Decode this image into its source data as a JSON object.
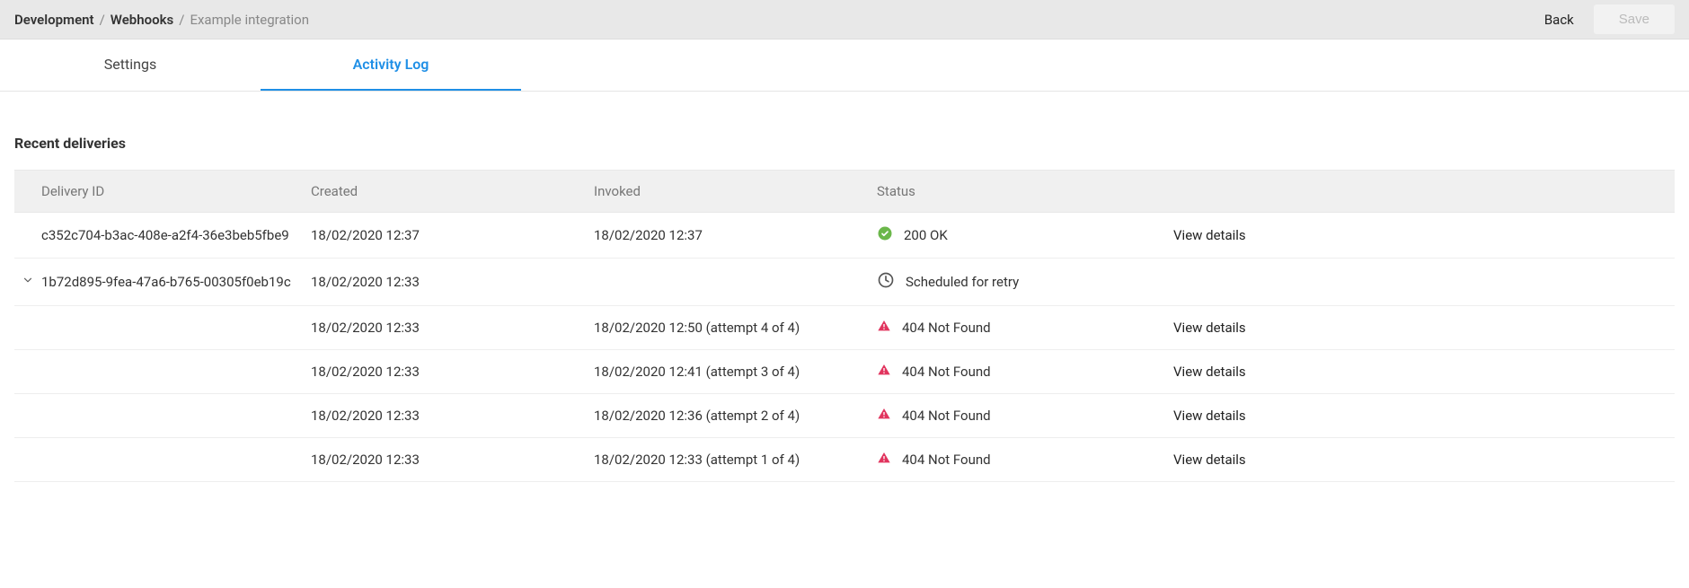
{
  "breadcrumb": {
    "item0": "Development",
    "item1": "Webhooks",
    "item2": "Example integration",
    "sep": "/"
  },
  "topbar": {
    "back": "Back",
    "save": "Save"
  },
  "tabs": {
    "settings": "Settings",
    "activity": "Activity Log"
  },
  "section": {
    "title": "Recent deliveries"
  },
  "table": {
    "headers": {
      "id": "Delivery ID",
      "created": "Created",
      "invoked": "Invoked",
      "status": "Status"
    },
    "rows": [
      {
        "id": "c352c704-b3ac-408e-a2f4-36e3beb5fbe9",
        "created": "18/02/2020 12:37",
        "invoked": "18/02/2020 12:37",
        "status_text": "200 OK",
        "action": "View details"
      },
      {
        "id": "1b72d895-9fea-47a6-b765-00305f0eb19c",
        "created": "18/02/2020 12:33",
        "invoked": "",
        "status_text": "Scheduled for retry",
        "action": ""
      }
    ],
    "attempts": [
      {
        "created": "18/02/2020 12:33",
        "invoked": "18/02/2020 12:50 (attempt 4 of 4)",
        "status_text": "404 Not Found",
        "action": "View details"
      },
      {
        "created": "18/02/2020 12:33",
        "invoked": "18/02/2020 12:41 (attempt 3 of 4)",
        "status_text": "404 Not Found",
        "action": "View details"
      },
      {
        "created": "18/02/2020 12:33",
        "invoked": "18/02/2020 12:36 (attempt 2 of 4)",
        "status_text": "404 Not Found",
        "action": "View details"
      },
      {
        "created": "18/02/2020 12:33",
        "invoked": "18/02/2020 12:33 (attempt 1 of 4)",
        "status_text": "404 Not Found",
        "action": "View details"
      }
    ]
  }
}
